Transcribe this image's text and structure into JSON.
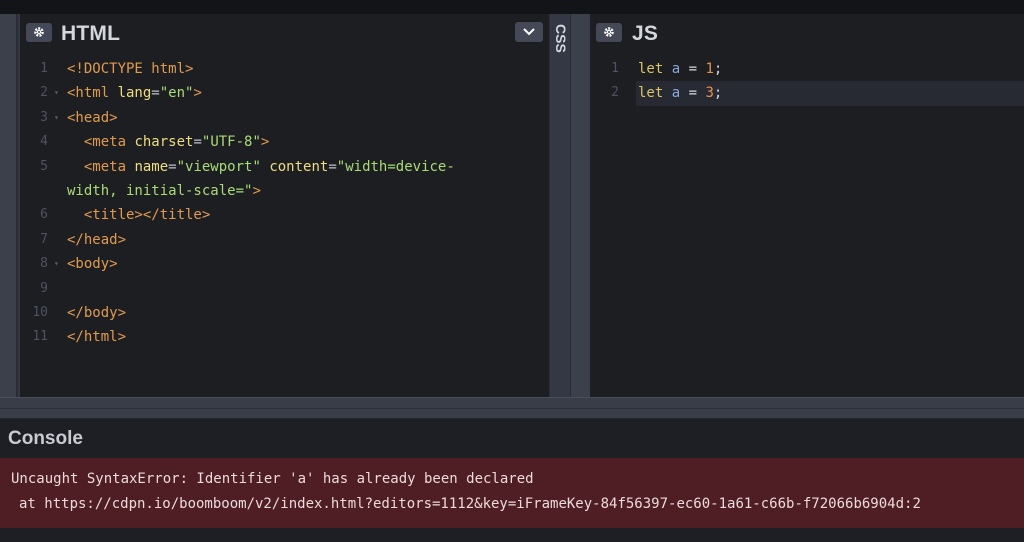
{
  "html_panel": {
    "title": "HTML",
    "lines": [
      {
        "n": "1",
        "fold": false,
        "tokens": [
          [
            "tag",
            "<!DOCTYPE html>"
          ]
        ]
      },
      {
        "n": "2",
        "fold": true,
        "tokens": [
          [
            "tag",
            "<html "
          ],
          [
            "attr",
            "lang"
          ],
          [
            "punct",
            "="
          ],
          [
            "str",
            "\"en\""
          ],
          [
            "tag",
            ">"
          ]
        ]
      },
      {
        "n": "3",
        "fold": true,
        "tokens": [
          [
            "tag",
            "<head>"
          ]
        ]
      },
      {
        "n": "4",
        "fold": false,
        "tokens": [
          [
            "plain",
            "  "
          ],
          [
            "tag",
            "<meta "
          ],
          [
            "attr",
            "charset"
          ],
          [
            "punct",
            "="
          ],
          [
            "str",
            "\"UTF-8\""
          ],
          [
            "tag",
            ">"
          ]
        ]
      },
      {
        "n": "5",
        "fold": false,
        "wrap": true,
        "tokens": [
          [
            "plain",
            "  "
          ],
          [
            "tag",
            "<meta "
          ],
          [
            "attr",
            "name"
          ],
          [
            "punct",
            "="
          ],
          [
            "str",
            "\"viewport\""
          ],
          [
            "plain",
            " "
          ],
          [
            "attr",
            "content"
          ],
          [
            "punct",
            "="
          ],
          [
            "str",
            "\"width=device-\nwidth, initial-scale=\""
          ],
          [
            "tag",
            ">"
          ]
        ]
      },
      {
        "n": "6",
        "fold": false,
        "tokens": [
          [
            "plain",
            "  "
          ],
          [
            "tag",
            "<title></title>"
          ]
        ]
      },
      {
        "n": "7",
        "fold": false,
        "tokens": [
          [
            "tag",
            "</head>"
          ]
        ]
      },
      {
        "n": "8",
        "fold": true,
        "tokens": [
          [
            "tag",
            "<body>"
          ]
        ]
      },
      {
        "n": "9",
        "fold": false,
        "tokens": []
      },
      {
        "n": "10",
        "fold": false,
        "tokens": [
          [
            "tag",
            "</body>"
          ]
        ]
      },
      {
        "n": "11",
        "fold": false,
        "tokens": [
          [
            "tag",
            "</html>"
          ]
        ]
      }
    ]
  },
  "css_panel": {
    "title": "CSS"
  },
  "js_panel": {
    "title": "JS",
    "lines": [
      {
        "n": "1",
        "tokens": [
          [
            "kw",
            "let "
          ],
          [
            "ident",
            "a"
          ],
          [
            "plain",
            " = "
          ],
          [
            "num",
            "1"
          ],
          [
            "plain",
            ";"
          ]
        ]
      },
      {
        "n": "2",
        "tokens": [
          [
            "kw",
            "let "
          ],
          [
            "ident",
            "a"
          ],
          [
            "plain",
            " = "
          ],
          [
            "num",
            "3"
          ],
          [
            "plain",
            ";"
          ]
        ]
      }
    ]
  },
  "console": {
    "heading": "Console",
    "error_line1": "Uncaught SyntaxError: Identifier 'a' has already been declared",
    "error_line2": "at https://cdpn.io/boomboom/v2/index.html?editors=1112&key=iFrameKey-84f56397-ec60-1a61-c66b-f72066b6904d:2"
  },
  "icons": {
    "settings": "gear-icon",
    "collapse": "chevron-down-icon"
  },
  "colors": {
    "editor_bg": "#1d1e22",
    "tag": "#e09b4f",
    "attribute": "#eedd82",
    "string": "#a8dc76",
    "keyword": "#dbc669",
    "number": "#e8914c",
    "error_bg": "#4e1e24"
  }
}
